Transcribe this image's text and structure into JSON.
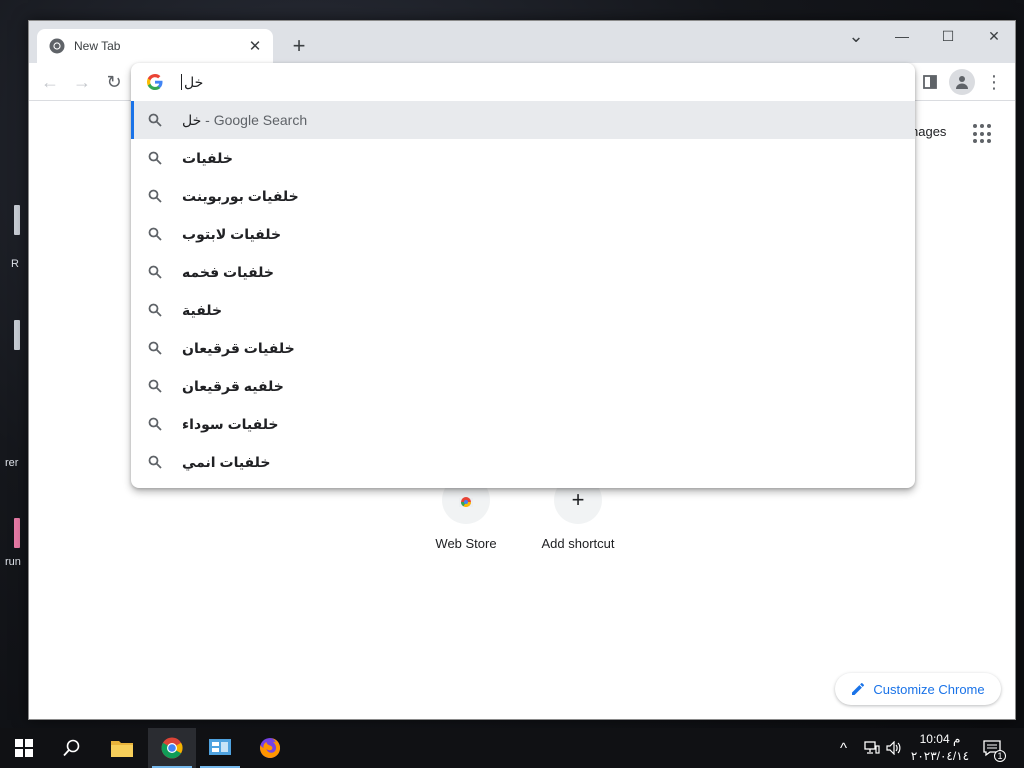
{
  "desktop": {
    "fragments": [
      "R",
      "rer",
      "run"
    ]
  },
  "browser": {
    "tab": {
      "title": "New Tab",
      "close_glyph": "✕"
    },
    "new_tab_glyph": "+",
    "window_controls": {
      "tab_search": "⌄",
      "minimize": "—",
      "maximize": "☐",
      "close": "✕"
    },
    "toolbar": {
      "back": "←",
      "forward": "→",
      "reload": "↻",
      "menu": "⋮"
    },
    "omnibox": {
      "typed_text": "خل",
      "suggestions": [
        {
          "typed": "خل",
          "suffix": " - Google Search",
          "selected": true
        },
        {
          "text": "خلفيات"
        },
        {
          "text": "خلفيات بوربوينت"
        },
        {
          "text": "خلفيات لابتوب"
        },
        {
          "text": "خلفيات فخمه"
        },
        {
          "text": "خلفية"
        },
        {
          "text": "خلفيات قرقيعان"
        },
        {
          "text": "خلفيه قرقيعان"
        },
        {
          "text": "خلفيات سوداء"
        },
        {
          "text": "خلفيات انمي"
        }
      ]
    },
    "ntp": {
      "images_link": "nages",
      "shortcuts": [
        {
          "label": "Web Store",
          "icon": "webstore-icon"
        },
        {
          "label": "Add shortcut",
          "icon": "plus-icon",
          "glyph": "+"
        }
      ],
      "customize_label": "Customize Chrome"
    }
  },
  "taskbar": {
    "apps": [
      "start",
      "search",
      "file-explorer",
      "chrome",
      "control-panel",
      "firefox"
    ],
    "tray": {
      "chevron": "^",
      "network": "🖧",
      "volume": "🔊"
    },
    "clock": {
      "time": "10:04 م",
      "date": "٢٠٢٣/٠٤/١٤"
    },
    "notification_count": "1"
  },
  "colors": {
    "accent": "#1a73e8",
    "tabstrip": "#dee1e6",
    "selected_row": "#e8eaed"
  }
}
